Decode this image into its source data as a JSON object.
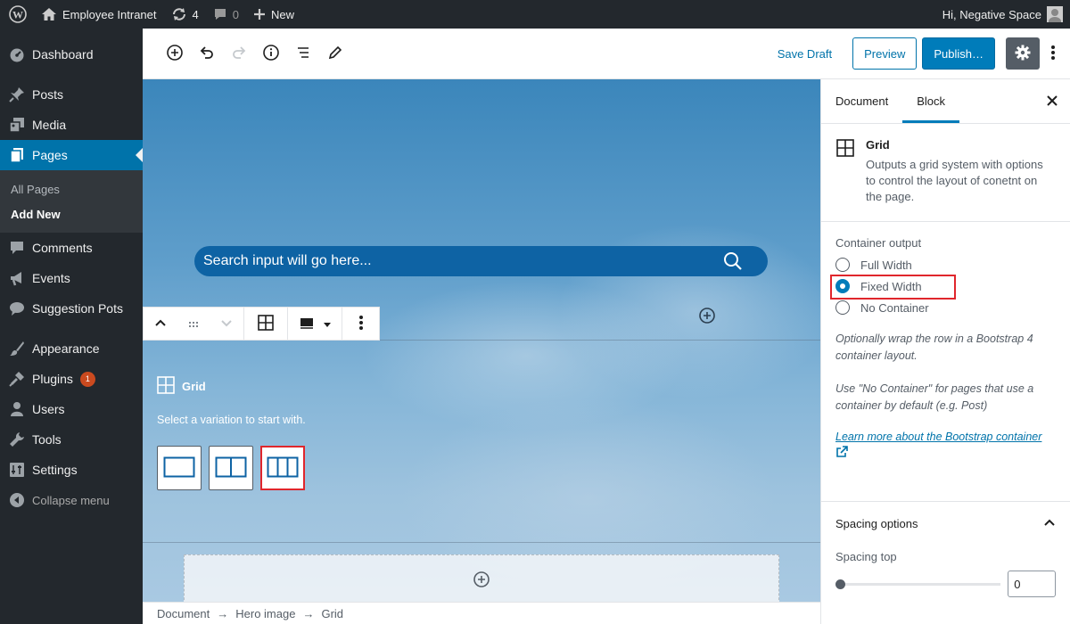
{
  "admin_bar": {
    "site_name": "Employee Intranet",
    "updates_count": "4",
    "comments_count": "0",
    "new_label": "New",
    "greeting": "Hi, Negative Space"
  },
  "sidebar": {
    "items": [
      {
        "label": "Dashboard",
        "icon": "dashboard-icon"
      },
      {
        "label": "Posts",
        "icon": "pin-icon"
      },
      {
        "label": "Media",
        "icon": "media-icon"
      },
      {
        "label": "Pages",
        "icon": "pages-icon"
      },
      {
        "label": "Comments",
        "icon": "comment-icon"
      },
      {
        "label": "Events",
        "icon": "megaphone-icon"
      },
      {
        "label": "Suggestion Pots",
        "icon": "chat-icon"
      },
      {
        "label": "Appearance",
        "icon": "brush-icon"
      },
      {
        "label": "Plugins",
        "icon": "plug-icon",
        "badge": "1"
      },
      {
        "label": "Users",
        "icon": "user-icon"
      },
      {
        "label": "Tools",
        "icon": "wrench-icon"
      },
      {
        "label": "Settings",
        "icon": "settings-icon"
      }
    ],
    "submenu": [
      "All Pages",
      "Add New"
    ],
    "collapse_label": "Collapse menu"
  },
  "editor_header": {
    "save_draft": "Save Draft",
    "preview": "Preview",
    "publish": "Publish…"
  },
  "canvas": {
    "search_placeholder": "Search input will go here...",
    "grid_title": "Grid",
    "grid_desc": "Select a variation to start with."
  },
  "breadcrumb": [
    "Document",
    "Hero image",
    "Grid"
  ],
  "breadcrumb_sep": "→",
  "inspector": {
    "tabs": [
      "Document",
      "Block"
    ],
    "block_title": "Grid",
    "block_desc": "Outputs a grid system with options to control the layout of conetnt on the page.",
    "container_label": "Container output",
    "options": [
      "Full Width",
      "Fixed Width",
      "No Container"
    ],
    "selected_option": "Fixed Width",
    "help1": "Optionally wrap the row in a Bootstrap 4 container layout.",
    "help2": "Use \"No Container\" for pages that use a container by default (e.g. Post)",
    "link": "Learn more about the Bootstrap container",
    "spacing_title": "Spacing options",
    "spacing_top_label": "Spacing top",
    "spacing_top_value": "0"
  },
  "colors": {
    "admin_bg": "#23282d",
    "accent": "#0073aa",
    "highlight": "#e0262c"
  }
}
